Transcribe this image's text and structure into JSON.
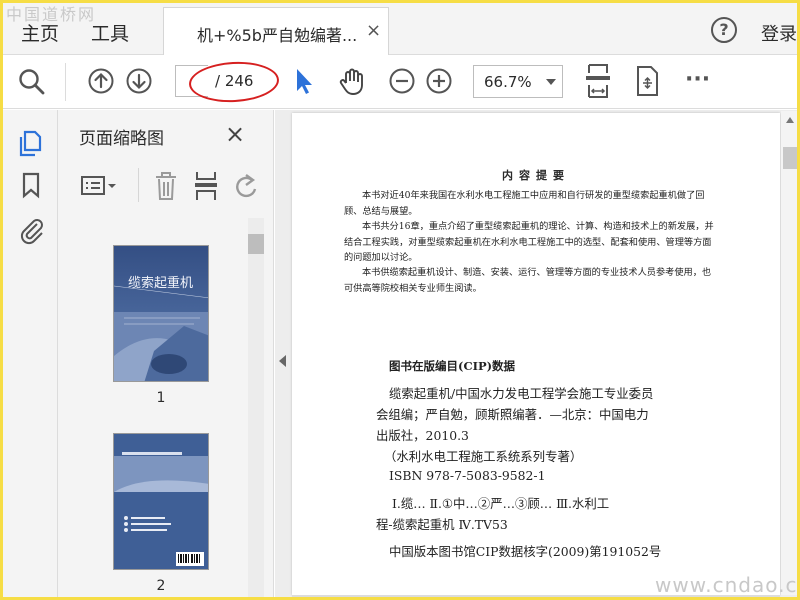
{
  "watermark": {
    "top": "中国道桥网",
    "bottom": "www.cndao.com"
  },
  "tabbar": {
    "home": "主页",
    "tools": "工具",
    "doc_tab_title": "机+%5b严自勉编著...",
    "close_glyph": "×",
    "help_glyph": "?",
    "login": "登录"
  },
  "toolbar": {
    "page_total": "/ 246",
    "zoom": "66.7%",
    "more_glyph": "···",
    "highlight_color": "#d62020"
  },
  "panel": {
    "title": "页面缩略图",
    "close_glyph": "×",
    "thumbnails": [
      {
        "label": "1",
        "cover_title": "缆索起重机"
      },
      {
        "label": "2"
      }
    ]
  },
  "document": {
    "summary_title": "内容提要",
    "summary_paragraphs": [
      "本书对近40年来我国在水利水电工程施工中应用和自行研发的重型缆索起重机做了回顾、总结与展望。",
      "本书共分16章，重点介绍了重型缆索起重机的理论、计算、构造和技术上的新发展，并结合工程实践，对重型缆索起重机在水利水电工程施工中的选型、配套和使用、管理等方面的问题加以讨论。",
      "本书供缆索起重机设计、制造、安装、运行、管理等方面的专业技术人员参考使用，也可供高等院校相关专业师生阅读。"
    ],
    "cip_title": "图书在版编目(CIP)数据",
    "cip_lines": [
      "缆索起重机/中国水力发电工程学会施工专业委员",
      "会组编；严自勉，顾斯照编著．—北京：中国电力",
      "出版社，2010.3",
      "（水利水电工程施工系统系列专著）",
      "ISBN 978-7-5083-9582-1",
      "Ⅰ.缆…  Ⅱ.①中…②严…③顾…  Ⅲ.水利工",
      "程-缆索起重机  Ⅳ.TV53",
      "中国版本图书馆CIP数据核字(2009)第191052号"
    ]
  },
  "icons": [
    "search-icon",
    "prev-page-icon",
    "next-page-icon",
    "select-cursor-icon",
    "hand-tool-icon",
    "zoom-out-icon",
    "zoom-in-icon",
    "fit-page-icon",
    "rotate-icon",
    "more-icon",
    "thumbnails-icon",
    "bookmark-icon",
    "attachment-icon",
    "thumbnail-options-icon",
    "delete-page-icon",
    "insert-page-icon",
    "undo-icon"
  ]
}
